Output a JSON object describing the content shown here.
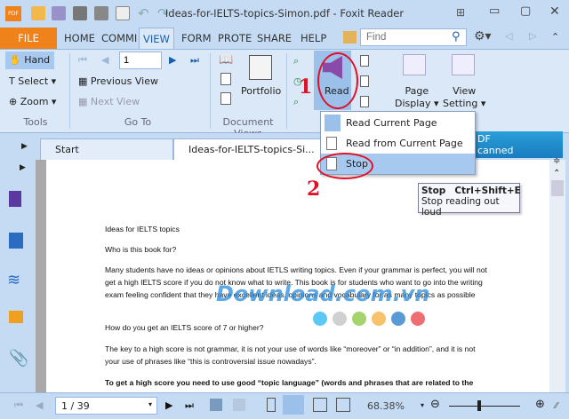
{
  "window": {
    "title": "Ideas-for-IELTS-topics-Simon.pdf - Foxit Reader",
    "logo": "PDF"
  },
  "menu_tabs": [
    "FILE",
    "HOME",
    "COMMI",
    "VIEW",
    "FORM",
    "PROTE",
    "SHARE",
    "HELP"
  ],
  "active_tab": "VIEW",
  "find": {
    "placeholder": "Find"
  },
  "ribbon": {
    "tools": {
      "hand": "Hand",
      "select": "Select",
      "zoom": "Zoom",
      "group": "Tools"
    },
    "goto": {
      "page": "1",
      "previous_view": "Previous View",
      "next_view": "Next View",
      "group": "Go To"
    },
    "docviews": {
      "portfolio": "Portfolio",
      "group": "Document Views"
    },
    "read": "Read",
    "page_display": [
      "Page",
      "Display"
    ],
    "view_setting": [
      "View",
      "Setting"
    ]
  },
  "doc_tabs": [
    "Start",
    "Ideas-for-IELTS-topics-Si..."
  ],
  "ad_text": [
    "DF",
    "canned documents"
  ],
  "read_menu": [
    "Read Current Page",
    "Read from Current Page",
    "Stop"
  ],
  "tooltip": {
    "title": "Stop",
    "shortcut": "Ctrl+Shift+E",
    "desc": "Stop reading out loud"
  },
  "annotations": [
    "1",
    "2"
  ],
  "document": {
    "lines": [
      "Ideas for IELTS topics",
      "Who is this book for?",
      "Many students have no ideas or opinions about IETLS writing topics. Even if your grammar is perfect, you will not get a high IELTS score if you do not know what to write. This book is for students who want to go into the writing exam feeling confident that they have excellent ideas, opinions and vocabulary for as many topics as possible",
      "How do you get an IELTS score of 7 or higher?",
      "The key to a high score is not grammar, it is not your use of words like “moreover” or “in addition”, and it is not your use of phrases like “this is controversial issue nowadays”.",
      "To get a high score you need to use good “topic language” (words and phrases that are related to the"
    ],
    "watermark": "Download.com.vn",
    "watermark_dots": [
      "#5bc8f5",
      "#d0d0d0",
      "#a6d46c",
      "#f8c26a",
      "#5b9bd5",
      "#ee6e73"
    ]
  },
  "status": {
    "page": "1 / 39",
    "zoom": "68.38%",
    "zoom_level": 0.5
  },
  "colors": {
    "file_tab": "#f0821b",
    "ribbon": "#dbe8f7",
    "accent": "#e0122a"
  }
}
